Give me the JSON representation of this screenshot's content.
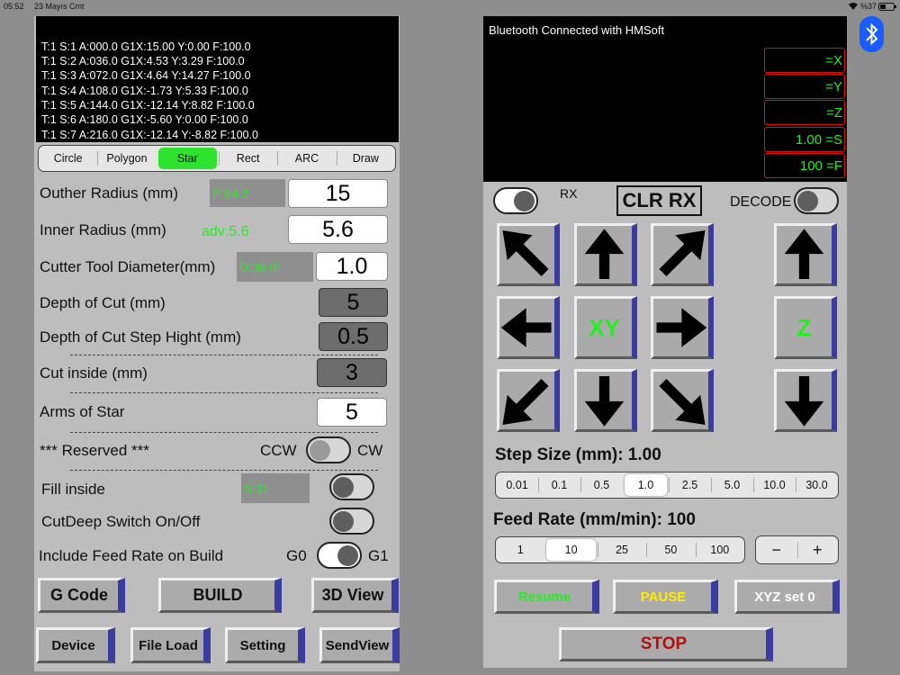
{
  "status_bar": {
    "time": "05:52",
    "date": "23 Mayıs Cmt",
    "battery": "%37"
  },
  "gcode_console": {
    "lines": [
      "T:1 S:1 A:000.0 G1X:15.00 Y:0.00 F:100.0",
      "T:1 S:2 A:036.0 G1X:4.53 Y:3.29 F:100.0",
      "T:1 S:3 A:072.0 G1X:4.64 Y:14.27 F:100.0",
      "T:1 S:4 A:108.0 G1X:-1.73 Y:5.33 F:100.0",
      "T:1 S:5 A:144.0 G1X:-12.14 Y:8.82 F:100.0",
      "T:1 S:6 A:180.0 G1X:-5.60 Y:0.00 F:100.0",
      "T:1 S:7 A:216.0 G1X:-12.14 Y:-8.82 F:100.0"
    ]
  },
  "shape_tabs": [
    "Circle",
    "Polygon",
    "Star",
    "Rect",
    "ARC",
    "Draw"
  ],
  "shape_selected": "Star",
  "form": {
    "outer_radius": {
      "label": "Outher Radius (mm)",
      "info": "P:94.2",
      "value": "15"
    },
    "inner_radius": {
      "label": "Inner Radius (mm)",
      "info": "adv:5.6",
      "value": "5.6"
    },
    "cutter_diameter": {
      "label": "Cutter Tool Diameter(mm)",
      "info": "D:36.0°",
      "value": "1.0"
    },
    "depth_of_cut": {
      "label": "Depth of Cut (mm)",
      "value": "5"
    },
    "depth_step": {
      "label": "Depth of Cut Step Hight (mm)",
      "value": "0.5"
    },
    "cut_inside": {
      "label": "Cut inside (mm)",
      "value": "3"
    },
    "arms_of_star": {
      "label": "Arms of Star",
      "value": "5"
    },
    "reserved": {
      "label": "*** Reserved ***",
      "left": "CCW",
      "right": "CW"
    },
    "fill_inside": {
      "label": "Fill inside",
      "info": "S:11"
    },
    "cutdeep": {
      "label": "CutDeep Switch On/Off"
    },
    "feed_rate_build": {
      "label": "Include Feed Rate on Build",
      "left": "G0",
      "right": "G1"
    }
  },
  "actions": {
    "gcode": "G Code",
    "build": "BUILD",
    "view3d": "3D View"
  },
  "bottom_nav": {
    "device": "Device",
    "file_load": "File Load",
    "setting": "Setting",
    "sendview": "SendView"
  },
  "bluetooth_console": {
    "message": "Bluetooth Connected with HMSoft"
  },
  "coordinates": {
    "x": "=X",
    "y": "=Y",
    "z": "=Z",
    "s": "1.00 =S",
    "f": "100 =F"
  },
  "controls": {
    "rx_label": "RX",
    "clr_rx": "CLR RX",
    "decode_label": "DECODE",
    "xy_label": "XY",
    "z_label": "Z"
  },
  "step_size": {
    "label": "Step Size (mm): 1.00",
    "options": [
      "0.01",
      "0.1",
      "0.5",
      "1.0",
      "2.5",
      "5.0",
      "10.0",
      "30.0"
    ],
    "selected": "1.0"
  },
  "feed_rate": {
    "label": "Feed Rate (mm/min): 100",
    "options": [
      "1",
      "10",
      "25",
      "50",
      "100"
    ],
    "selected": "10",
    "minus": "−",
    "plus": "+"
  },
  "run_controls": {
    "resume": "Resume",
    "pause": "PAUSE",
    "xyz_set0": "XYZ set 0",
    "stop": "STOP"
  },
  "colors": {
    "green": "#22ee22",
    "yellow": "#ffee00",
    "stop_red": "#b01010",
    "accent_blue": "#3c3ca0",
    "bluetooth": "#1a5cff"
  }
}
